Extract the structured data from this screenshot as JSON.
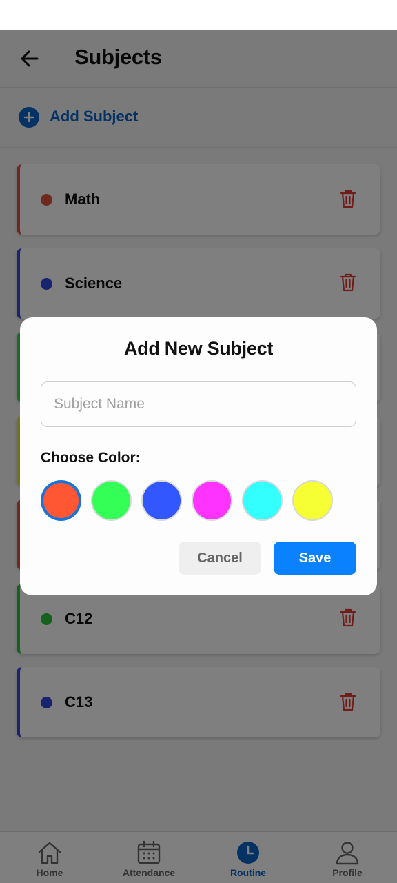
{
  "header": {
    "title": "Subjects",
    "back_icon": "arrow-left-icon"
  },
  "add_subject": {
    "label": "Add Subject",
    "icon": "plus-circle-icon"
  },
  "subjects": [
    {
      "name": "Math",
      "color": "#e0533d"
    },
    {
      "name": "Science",
      "color": "#3148e0"
    },
    {
      "name": "",
      "color": "#39d44a"
    },
    {
      "name": "",
      "color": "#e6e62e"
    },
    {
      "name": "",
      "color": "#e0533d"
    },
    {
      "name": "C12",
      "color": "#2bc43f"
    },
    {
      "name": "C13",
      "color": "#3148e0"
    }
  ],
  "delete_icon": "trash-icon",
  "delete_color": "#e53935",
  "bottom_nav": [
    {
      "label": "Home",
      "icon": "home-icon",
      "active": false
    },
    {
      "label": "Attendance",
      "icon": "calendar-icon",
      "active": false
    },
    {
      "label": "Routine",
      "icon": "clock-icon",
      "active": true
    },
    {
      "label": "Profile",
      "icon": "user-icon",
      "active": false
    }
  ],
  "modal": {
    "title": "Add New Subject",
    "input": {
      "placeholder": "Subject Name",
      "value": ""
    },
    "color_label": "Choose Color:",
    "colors": [
      "#ff5733",
      "#33ff57",
      "#3357ff",
      "#ff33ff",
      "#33ffff",
      "#f5ff33"
    ],
    "selected_color_index": 0,
    "cancel_label": "Cancel",
    "save_label": "Save"
  },
  "accent_color": "#0a64c8",
  "save_button_color": "#0a82ff"
}
